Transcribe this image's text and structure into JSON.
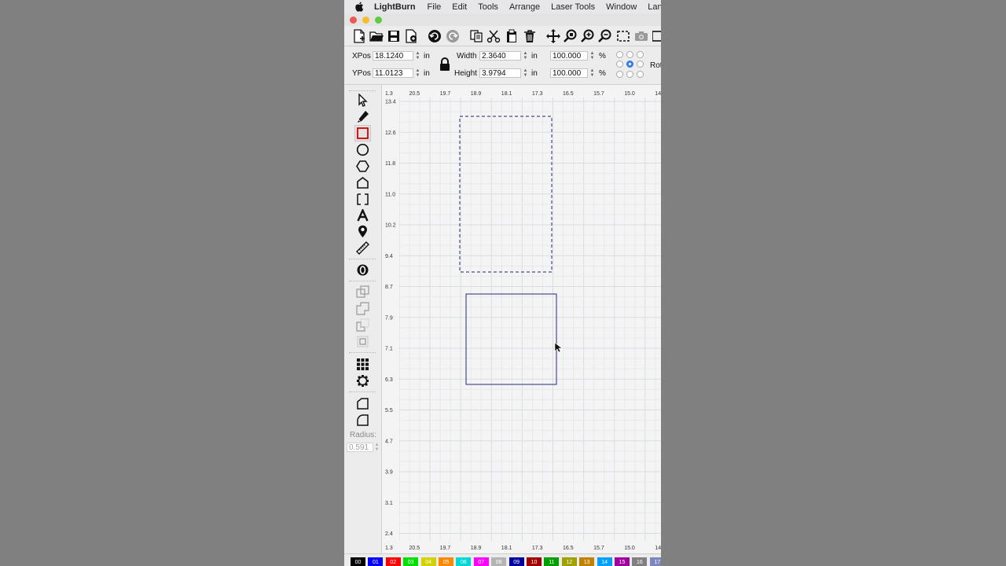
{
  "menubar": {
    "app_name": "LightBurn",
    "items": [
      "File",
      "Edit",
      "Tools",
      "Arrange",
      "Laser Tools",
      "Window",
      "Lang"
    ]
  },
  "toolbar": {
    "buttons": [
      "new-file",
      "open-file",
      "save",
      "save-as",
      "undo",
      "redo",
      "copy",
      "cut",
      "paste",
      "delete",
      "move",
      "zoom-to-page",
      "zoom-in",
      "zoom-out",
      "frame-selection",
      "camera",
      "more"
    ]
  },
  "position": {
    "xpos_label": "XPos",
    "xpos_value": "18.1240",
    "xpos_unit": "in",
    "ypos_label": "YPos",
    "ypos_value": "11.0123",
    "ypos_unit": "in",
    "width_label": "Width",
    "width_value": "2.3640",
    "width_unit": "in",
    "height_label": "Height",
    "height_value": "3.9794",
    "height_unit": "in",
    "scale_w_value": "100.000",
    "scale_w_unit": "%",
    "scale_h_value": "100.000",
    "scale_h_unit": "%",
    "rotate_label": "Rot",
    "anchor_selected": "center"
  },
  "tools": {
    "radius_label": "Radius:",
    "radius_value": "0.591"
  },
  "ruler": {
    "top": [
      "1.3",
      "20.5",
      "19.7",
      "18.9",
      "18.1",
      "17.3",
      "16.5",
      "15.7",
      "15.0",
      "14"
    ],
    "left": [
      "13.4",
      "12.6",
      "11.8",
      "11.0",
      "10.2",
      "9.4",
      "8.7",
      "7.9",
      "7.1",
      "6.3",
      "5.5",
      "4.7",
      "3.9",
      "3.1",
      "2.4"
    ]
  },
  "palette": [
    {
      "label": "00",
      "color": "#000000"
    },
    {
      "label": "01",
      "color": "#0000ff"
    },
    {
      "label": "02",
      "color": "#ff0000"
    },
    {
      "label": "03",
      "color": "#00e000"
    },
    {
      "label": "04",
      "color": "#d2d200"
    },
    {
      "label": "05",
      "color": "#ff8800"
    },
    {
      "label": "06",
      "color": "#00d8d8"
    },
    {
      "label": "07",
      "color": "#ff00ff"
    },
    {
      "label": "08",
      "color": "#b4b4b4"
    },
    {
      "label": "09",
      "color": "#0000a0"
    },
    {
      "label": "10",
      "color": "#a00000"
    },
    {
      "label": "11",
      "color": "#00a000"
    },
    {
      "label": "12",
      "color": "#a0a000"
    },
    {
      "label": "13",
      "color": "#c08000"
    },
    {
      "label": "14",
      "color": "#00a0ff"
    },
    {
      "label": "15",
      "color": "#a000a0"
    },
    {
      "label": "16",
      "color": "#808080"
    },
    {
      "label": "17",
      "color": "#7d87b9"
    }
  ],
  "colors": {
    "shape_stroke": "#4a4a8c",
    "rect_tool_highlight": "#d40000",
    "anchor_selected": "#3d86f0"
  }
}
